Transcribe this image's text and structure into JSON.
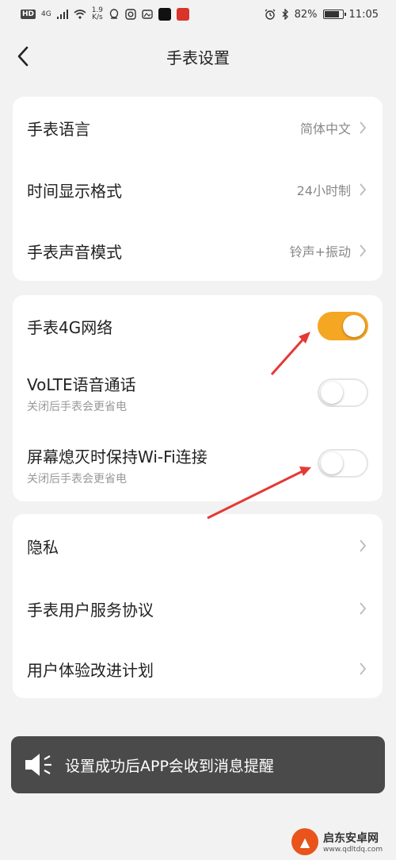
{
  "status_bar": {
    "badge": "HD",
    "network": "4G",
    "rate_top": "1.9",
    "rate_bottom": "K/s",
    "battery": "82%",
    "time": "11:05"
  },
  "header": {
    "title": "手表设置"
  },
  "group1": {
    "items": [
      {
        "label": "手表语言",
        "value": "简体中文"
      },
      {
        "label": "时间显示格式",
        "value": "24小时制"
      },
      {
        "label": "手表声音模式",
        "value": "铃声+振动"
      }
    ]
  },
  "group2": {
    "items": [
      {
        "label": "手表4G网络",
        "on": true
      },
      {
        "label": "VoLTE语音通话",
        "sub": "关闭后手表会更省电",
        "on": false
      },
      {
        "label": "屏幕熄灭时保持Wi-Fi连接",
        "sub": "关闭后手表会更省电",
        "on": false
      }
    ]
  },
  "group3": {
    "items": [
      {
        "label": "隐私"
      },
      {
        "label": "手表用户服务协议"
      },
      {
        "label": "用户体验改进计划"
      }
    ]
  },
  "toast": {
    "text": "设置成功后APP会收到消息提醒"
  },
  "watermark": {
    "name": "启东安卓网",
    "url": "www.qdltdq.com"
  },
  "colors": {
    "accent": "#f5a623",
    "arrow": "#e53935",
    "toast_bg": "#4a4a4a"
  }
}
